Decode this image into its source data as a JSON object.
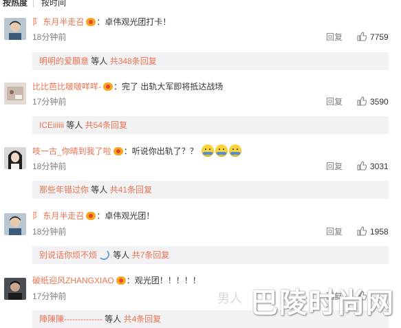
{
  "sort": {
    "hot": "按热度",
    "sep": "|",
    "time": "按时间"
  },
  "comments": [
    {
      "user": "东月半走召",
      "text": "：卓伟观光团打卡！",
      "time": "18分钟前",
      "reply_label": "回复",
      "likes": "7759",
      "sub_user": "明明的爱願意",
      "sub_mid": " 等人 ",
      "sub_count": "共348条回复"
    },
    {
      "user": "比比芭比啵啵咩咩-",
      "text": "：完了 出轨大军即将抵达战场",
      "time": "17分钟前",
      "reply_label": "回复",
      "likes": "3590",
      "sub_user": "ICEiiiiii",
      "sub_mid": " 等人 ",
      "sub_count": "共54条回复"
    },
    {
      "user": "吱一古_你晴到我了啦",
      "text": "：听说你出轨了？？",
      "time": "18分钟前",
      "reply_label": "回复",
      "likes": "3031",
      "sub_user": "那些年错过你",
      "sub_mid": " 等人 ",
      "sub_count": "共41条回复"
    },
    {
      "user": "东月半走召",
      "text": "：卓伟观光团！",
      "time": "18分钟前",
      "reply_label": "回复",
      "likes": "1958",
      "sub_user": "别说话你烦不烦",
      "sub_mid": " 等人 ",
      "sub_count": "共7条回复"
    },
    {
      "user": "破纸迎风ZHANGXIAO",
      "text": "：观光团！！！！！",
      "time": "17分钟前",
      "reply_label": "回复",
      "likes": "",
      "sub_user": "陣陳陳--------------",
      "sub_mid": " 等人 ",
      "sub_count": "共4条回复"
    }
  ],
  "watermark": {
    "main": "巴陵时尚网",
    "faint": "男人"
  },
  "colors": {
    "username": "#eb7350",
    "meta": "#808080",
    "subbg": "#f2f2f5"
  },
  "icons": {
    "like": "thumbs-up-icon",
    "vip": "vip-badge-icon",
    "emoji": "sweat-smile-emoji-icon"
  }
}
